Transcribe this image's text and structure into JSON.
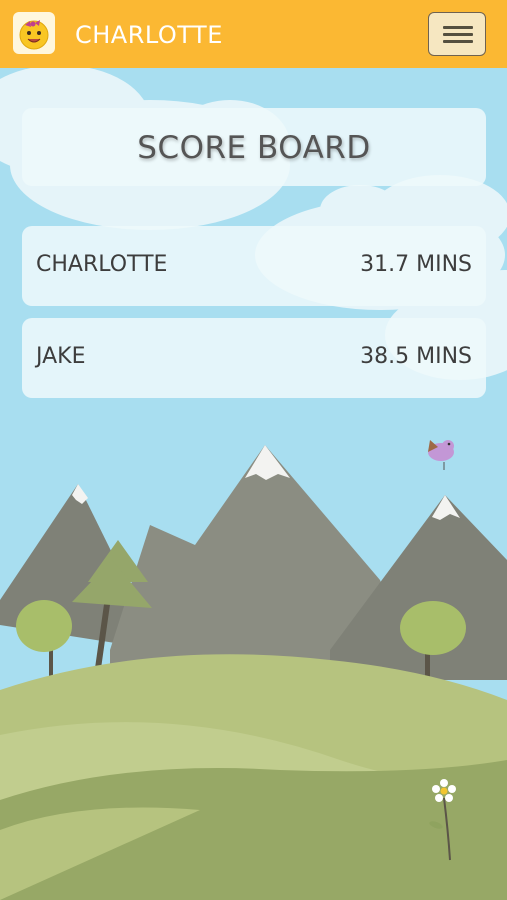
{
  "app": {
    "title": "CHARLOTTE",
    "icon": "emoji-face-icon",
    "menu_icon": "hamburger-menu-icon"
  },
  "board": {
    "title": "SCORE BOARD",
    "rows": [
      {
        "name": "CHARLOTTE",
        "score": "31.7 MINS"
      },
      {
        "name": "JAKE",
        "score": "38.5 MINS"
      }
    ]
  },
  "colors": {
    "header": "#fbb833",
    "sky": "#a8def0",
    "mountain": "#8c8e83",
    "hill_light": "#b6c37f",
    "hill_dark": "#97a866"
  }
}
